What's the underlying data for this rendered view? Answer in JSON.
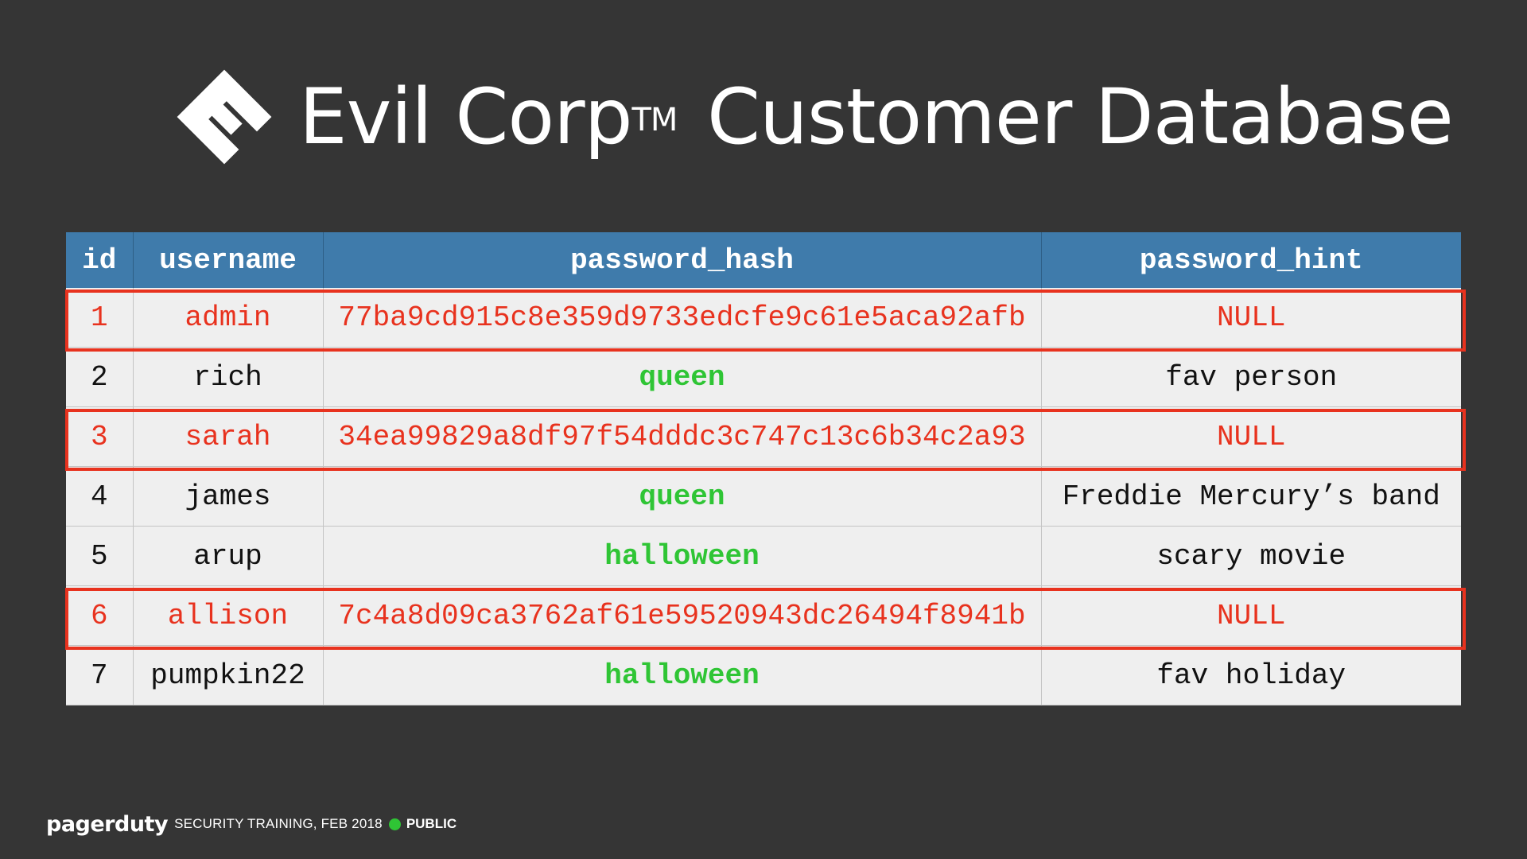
{
  "title": {
    "main": "Evil Corp",
    "trademark": "TM",
    "rest": "Customer Database"
  },
  "table": {
    "headers": [
      "id",
      "username",
      "password_hash",
      "password_hint"
    ],
    "rows": [
      {
        "id": "1",
        "username": "admin",
        "password_hash": "77ba9cd915c8e359d9733edcfe9c61e5aca92afb",
        "password_hint": "NULL"
      },
      {
        "id": "2",
        "username": "rich",
        "password_hash": "queen",
        "password_hint": "fav person"
      },
      {
        "id": "3",
        "username": "sarah",
        "password_hash": "34ea99829a8df97f54dddc3c747c13c6b34c2a93",
        "password_hint": "NULL"
      },
      {
        "id": "4",
        "username": "james",
        "password_hash": "queen",
        "password_hint": "Freddie Mercury’s band"
      },
      {
        "id": "5",
        "username": "arup",
        "password_hash": "halloween",
        "password_hint": "scary movie"
      },
      {
        "id": "6",
        "username": "allison",
        "password_hash": "7c4a8d09ca3762af61e59520943dc26494f8941b",
        "password_hint": "NULL"
      },
      {
        "id": "7",
        "username": "pumpkin22",
        "password_hash": "halloween",
        "password_hint": "fav holiday"
      }
    ]
  },
  "footer": {
    "brand": "pagerduty",
    "text": "SECURITY TRAINING, FEB 2018",
    "classification": "PUBLIC"
  },
  "colors": {
    "background": "#353535",
    "header_row": "#3f7bab",
    "highlight": "#e8321e",
    "cracked": "#2fc535",
    "row_bg": "#efefef"
  },
  "icons": {
    "logo": "evil-corp-logo-icon",
    "status_dot": "green-dot-icon"
  }
}
